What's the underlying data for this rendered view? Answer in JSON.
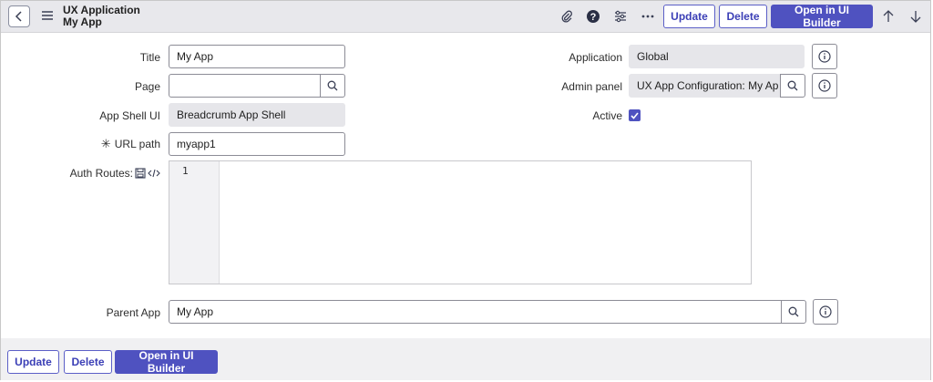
{
  "header": {
    "record_type": "UX Application",
    "record_name": "My App",
    "buttons": {
      "update": "Update",
      "delete": "Delete",
      "open_ui_builder": "Open in UI Builder"
    },
    "icons": [
      "back-icon",
      "menu-icon",
      "paperclip-icon",
      "help-icon",
      "settings-sliders-icon",
      "more-icon",
      "arrow-up-icon",
      "arrow-down-icon"
    ]
  },
  "form": {
    "title": {
      "label": "Title",
      "value": "My App"
    },
    "page": {
      "label": "Page",
      "value": ""
    },
    "app_shell_ui": {
      "label": "App Shell UI",
      "value": "Breadcrumb App Shell"
    },
    "url_path": {
      "label": "URL path",
      "value": "myapp1",
      "required_mark": "✳"
    },
    "auth_routes": {
      "label": "Auth Routes:",
      "line_number": "1"
    },
    "application": {
      "label": "Application",
      "value": "Global"
    },
    "admin_panel": {
      "label": "Admin panel",
      "value": "UX App Configuration: My App"
    },
    "active": {
      "label": "Active",
      "checked": true
    },
    "parent_app": {
      "label": "Parent App",
      "value": "My App"
    }
  },
  "footer": {
    "buttons": {
      "update": "Update",
      "delete": "Delete",
      "open_ui_builder": "Open in UI Builder"
    }
  },
  "colors": {
    "accent": "#4f52c0",
    "header_bg": "#e8e8ec",
    "readonly_bg": "#e6e6ea"
  }
}
